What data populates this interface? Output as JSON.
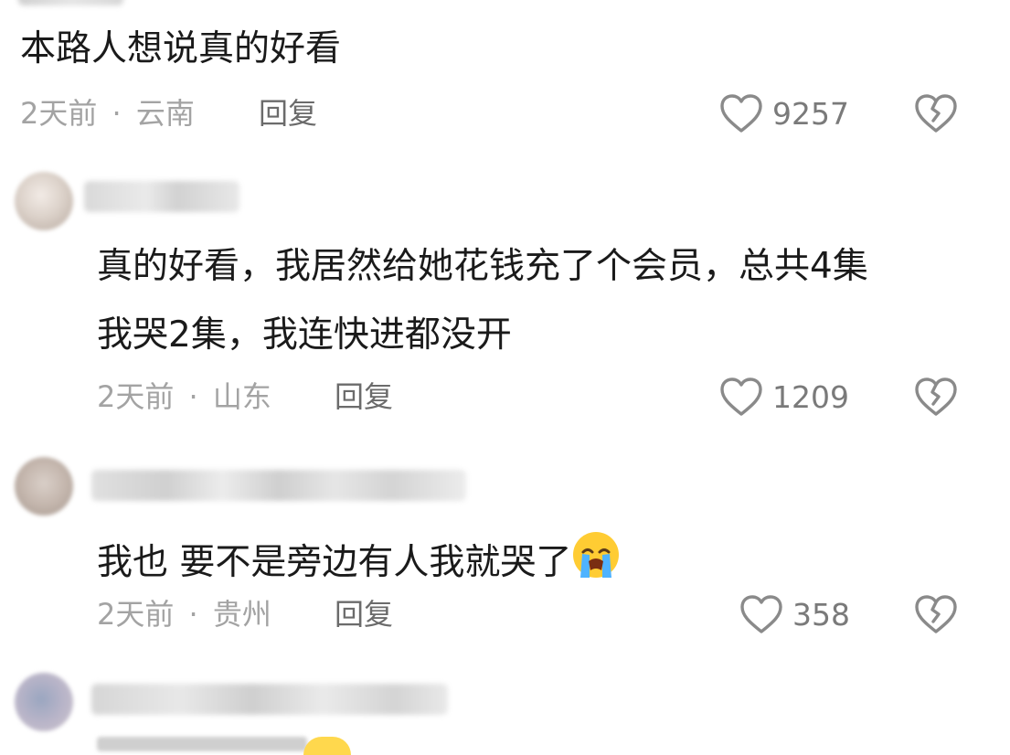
{
  "comments": [
    {
      "text": "本路人想说真的好看",
      "time": "2天前",
      "location": "云南",
      "separator": "·",
      "reply": "回复",
      "likes": "9257"
    },
    {
      "text_line1": "真的好看，我居然给她花钱充了个会员，总共4集",
      "text_line2": "我哭2集，我连快进都没开",
      "time": "2天前",
      "location": "山东",
      "separator": "·",
      "reply": "回复",
      "likes": "1209"
    },
    {
      "text": "我也 要不是旁边有人我就哭了",
      "emoji_icon": "loudly-crying-face-icon",
      "time": "2天前",
      "location": "贵州",
      "separator": "·",
      "reply": "回复",
      "likes": "358"
    }
  ],
  "icons": {
    "like": "heart-outline-icon",
    "dislike": "broken-heart-icon"
  },
  "colors": {
    "text": "#1a1a1a",
    "meta": "#a3a3a3",
    "icon": "#8a8a8a"
  }
}
